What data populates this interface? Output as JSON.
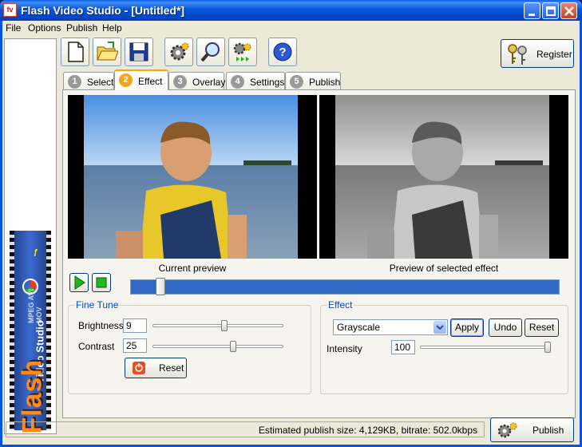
{
  "window": {
    "app_icon": "fv",
    "title": "Flash Video Studio - [Untitled*]"
  },
  "menu": [
    "File",
    "Options",
    "Publish",
    "Help"
  ],
  "sidebar_logo": {
    "word_primary": "Flash",
    "word_secondary": "Video Studio",
    "formats": "MPEG AVI MOV"
  },
  "toolbar": {
    "buttons": [
      "new-file-icon",
      "open-folder-icon",
      "save-disk-icon",
      "settings-gear-icon",
      "search-magnifier-icon",
      "publish-gears-icon",
      "help-icon"
    ],
    "register_label": "Register"
  },
  "tabs": [
    {
      "num": "1",
      "label": "Select"
    },
    {
      "num": "2",
      "label": "Effect"
    },
    {
      "num": "3",
      "label": "Overlay"
    },
    {
      "num": "4",
      "label": "Settings"
    },
    {
      "num": "5",
      "label": "Publish"
    }
  ],
  "active_tab": 1,
  "previews": {
    "current_caption": "Current preview",
    "effect_caption": "Preview of selected effect"
  },
  "player": {
    "seek_position": 0.06
  },
  "fine_tune": {
    "title": "Fine Tune",
    "brightness_label": "Brightness",
    "brightness_value": "9",
    "brightness_slider": 0.55,
    "contrast_label": "Contrast",
    "contrast_value": "25",
    "contrast_slider": 0.62,
    "reset_label": "Reset"
  },
  "effect": {
    "title": "Effect",
    "selected": "Grayscale",
    "apply_label": "Apply",
    "undo_label": "Undo",
    "reset_label": "Reset",
    "intensity_label": "Intensity",
    "intensity_value": "100",
    "intensity_slider": 1.0
  },
  "status": {
    "text": "Estimated publish size: 4,129KB, bitrate: 502.0kbps",
    "publish_label": "Publish"
  },
  "colors": {
    "title_bar": "#0054e3",
    "tab_accent": "#f4a61b",
    "seek_bar": "#316ac5",
    "group_title": "#0046d5"
  }
}
